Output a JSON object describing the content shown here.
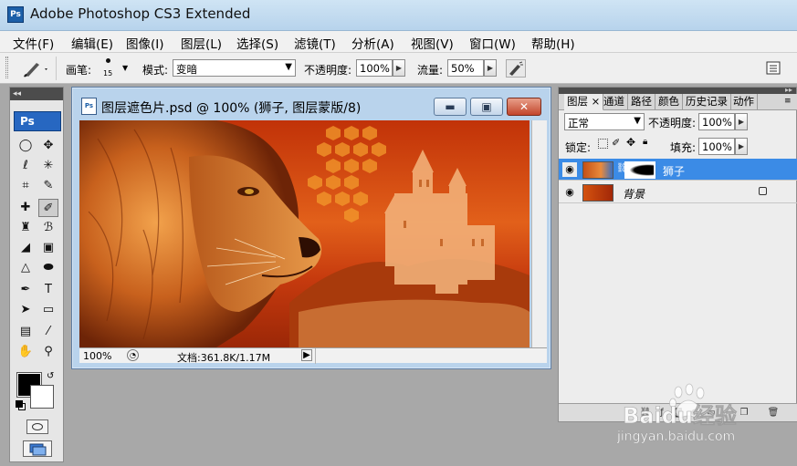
{
  "app": {
    "title": "Adobe Photoshop CS3 Extended",
    "icon": "Ps"
  },
  "menu": [
    "文件(F)",
    "编辑(E)",
    "图像(I)",
    "图层(L)",
    "选择(S)",
    "滤镜(T)",
    "分析(A)",
    "视图(V)",
    "窗口(W)",
    "帮助(H)"
  ],
  "options": {
    "brush_label": "画笔:",
    "brush_size": "15",
    "mode_label": "模式:",
    "mode_value": "变暗",
    "opacity_label": "不透明度:",
    "opacity_value": "100%",
    "flow_label": "流量:",
    "flow_value": "50%"
  },
  "toolbox": {
    "header": "◂◂",
    "logo": "Ps"
  },
  "document": {
    "title": "图层遮色片.psd @ 100% (狮子, 图层蒙版/8)",
    "zoom": "100%",
    "doc_info": "文档:361.8K/1.17M",
    "icon": "Ps"
  },
  "layers_panel": {
    "tabs": [
      "图层",
      "通道",
      "路径",
      "颜色",
      "历史记录",
      "动作"
    ],
    "tab_close": "×",
    "blend_mode": "正常",
    "opacity_label": "不透明度:",
    "opacity_value": "100%",
    "lock_label": "锁定:",
    "fill_label": "填充:",
    "fill_value": "100%",
    "layers": [
      {
        "name": "狮子",
        "selected": true
      },
      {
        "name": "背景",
        "selected": false
      }
    ]
  },
  "watermark": {
    "brand": "Baidu经验",
    "url": "jingyan.baidu.com"
  },
  "colors": {
    "selection": "#3b8be6",
    "title_bg": "#c3dbf0",
    "canvas_orange": "#d4520f"
  }
}
